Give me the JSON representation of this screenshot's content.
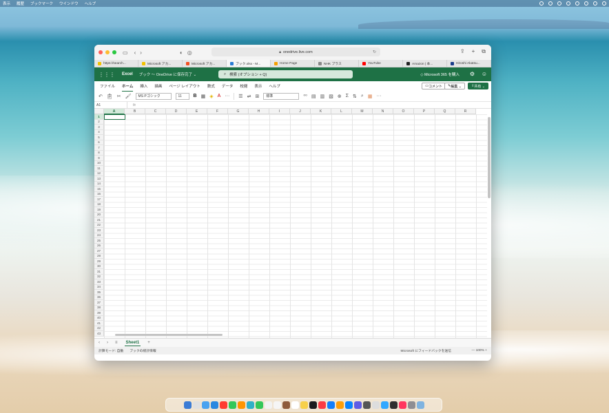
{
  "menubar": {
    "items": [
      "表示",
      "履歴",
      "ブックマーク",
      "ウインドウ",
      "ヘルプ"
    ]
  },
  "safari": {
    "url": "onedrive.live.com",
    "tabs": [
      {
        "label": "https://search...",
        "color": "#f2c200"
      },
      {
        "label": "Microsoft アカ...",
        "color": "#f2c200"
      },
      {
        "label": "Microsoft アカ...",
        "color": "#f25022"
      },
      {
        "label": "ブック.xlsx - M...",
        "color": "#2b7cd3",
        "active": true
      },
      {
        "label": "Home Page",
        "color": "#f4a000"
      },
      {
        "label": "NHK プラス",
        "color": "#888888"
      },
      {
        "label": "YouTube",
        "color": "#ff0000"
      },
      {
        "label": "Amazon | 本...",
        "color": "#222222"
      },
      {
        "label": "Hiroshi Akatsu...",
        "color": "#1a3c8a"
      }
    ]
  },
  "excel": {
    "app_name": "Excel",
    "doc_title": "ブック ～ OneDrive に保存完了 ⌄",
    "search_placeholder": "検索 (オプション + Q)",
    "m365": "Microsoft 365 を購入",
    "ribbon_tabs": [
      "ファイル",
      "ホーム",
      "挿入",
      "描画",
      "ページ レイアウト",
      "数式",
      "データ",
      "校閲",
      "表示",
      "ヘルプ"
    ],
    "active_tab": "ホーム",
    "comment_btn": "コメント",
    "edit_btn": "編集 ⌄",
    "share_btn": "共有 ⌄",
    "font_name": "MS Pゴシック",
    "font_size": "11",
    "number_format": "標準",
    "name_box": "A1",
    "fx": "fx",
    "columns": [
      "A",
      "B",
      "C",
      "D",
      "E",
      "F",
      "G",
      "H",
      "I",
      "J",
      "K",
      "L",
      "M",
      "N",
      "O",
      "P",
      "Q",
      "R"
    ],
    "selected_column": "A",
    "row_count": 43,
    "selected_row": 1,
    "sheet_name": "Sheet1",
    "status_left": "計算モード: 自動",
    "status_stats": "ブックの統計情報",
    "status_feedback": "Microsoft にフィードバックを送信",
    "zoom": "— 100% +"
  },
  "dock": {
    "colors": [
      "#3a7bd5",
      "#e0e0e0",
      "#4aa3f0",
      "#2a88e0",
      "#ff3b30",
      "#34c759",
      "#ff9500",
      "#30b0c7",
      "#34c759",
      "#f2f2f2",
      "#f5f5f5",
      "#8e5b3a",
      "#ffffff",
      "#f7d04a",
      "#1c1c1e",
      "#fc3c44",
      "#147efb",
      "#ff9f0a",
      "#0a84ff",
      "#5e5ce6",
      "#555555",
      "#dddddd",
      "#31a8ff",
      "#2f2f2f",
      "#ff375f",
      "#8e8e93",
      "#7fb3e0"
    ]
  }
}
